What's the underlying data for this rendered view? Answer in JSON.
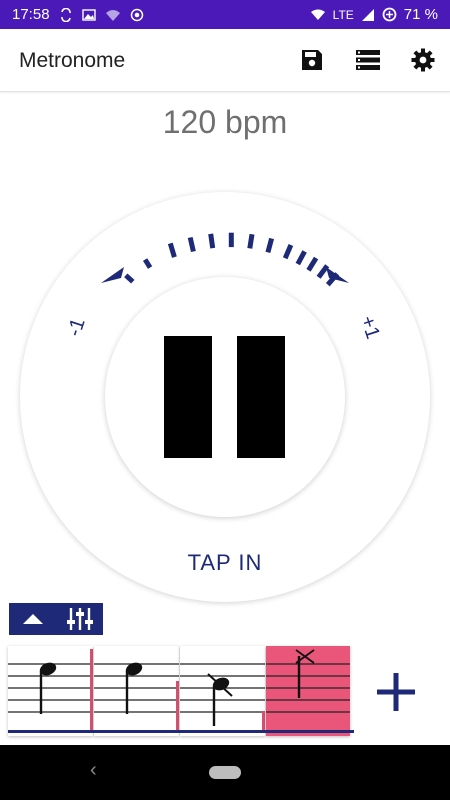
{
  "status_bar": {
    "time": "17:58",
    "network": "LTE",
    "battery": "71 %"
  },
  "app_bar": {
    "title": "Metronome",
    "actions": [
      {
        "name": "save",
        "icon": "floppy-disk-icon"
      },
      {
        "name": "list",
        "icon": "storage-list-icon"
      },
      {
        "name": "settings",
        "icon": "gear-icon"
      }
    ]
  },
  "tempo": {
    "bpm_label": "120 bpm"
  },
  "dial": {
    "minus_label": "-1",
    "plus_label": "+1",
    "tap_label": "TAP IN",
    "state": "playing",
    "center_icon": "pause-icon"
  },
  "beat_toolbar": {
    "collapse_icon": "triangle-up-icon",
    "mixer_icon": "sliders-icon"
  },
  "beats": [
    {
      "note": "quarter-note",
      "muted": false,
      "selected": false
    },
    {
      "note": "quarter-note",
      "muted": false,
      "selected": false
    },
    {
      "note": "quarter-note",
      "muted": true,
      "selected": false
    },
    {
      "note": "ghost-note",
      "muted": true,
      "selected": true
    }
  ],
  "colors": {
    "status_bar": "#4a19b8",
    "accent": "#1e2a78",
    "selected_beat": "#e9567a",
    "beat_marker": "#d9506f",
    "bpm_text": "#6f6f6f"
  },
  "add_beat_icon": "plus-icon"
}
